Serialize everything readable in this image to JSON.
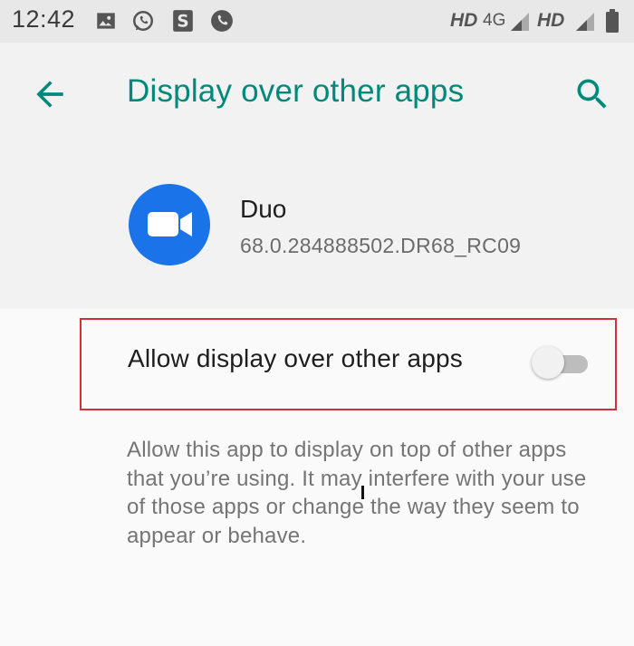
{
  "status_bar": {
    "time": "12:42",
    "notification_icons": [
      "image-icon",
      "whatsapp-icon",
      "s-app-icon",
      "phone-icon"
    ],
    "network1_label": "HD",
    "network_type": "4G",
    "network2_label": "HD"
  },
  "header": {
    "title": "Display over other apps"
  },
  "app": {
    "name": "Duo",
    "version": "68.0.284888502.DR68_RC09",
    "icon_color": "#1a73e8"
  },
  "setting": {
    "label": "Allow display over other apps",
    "enabled": false
  },
  "description": "Allow this app to display on top of other apps that you’re using. It may interfere with your use of those apps or change the way they seem to appear or behave.",
  "colors": {
    "accent": "#00897b",
    "highlight_border": "#d32f3a"
  }
}
